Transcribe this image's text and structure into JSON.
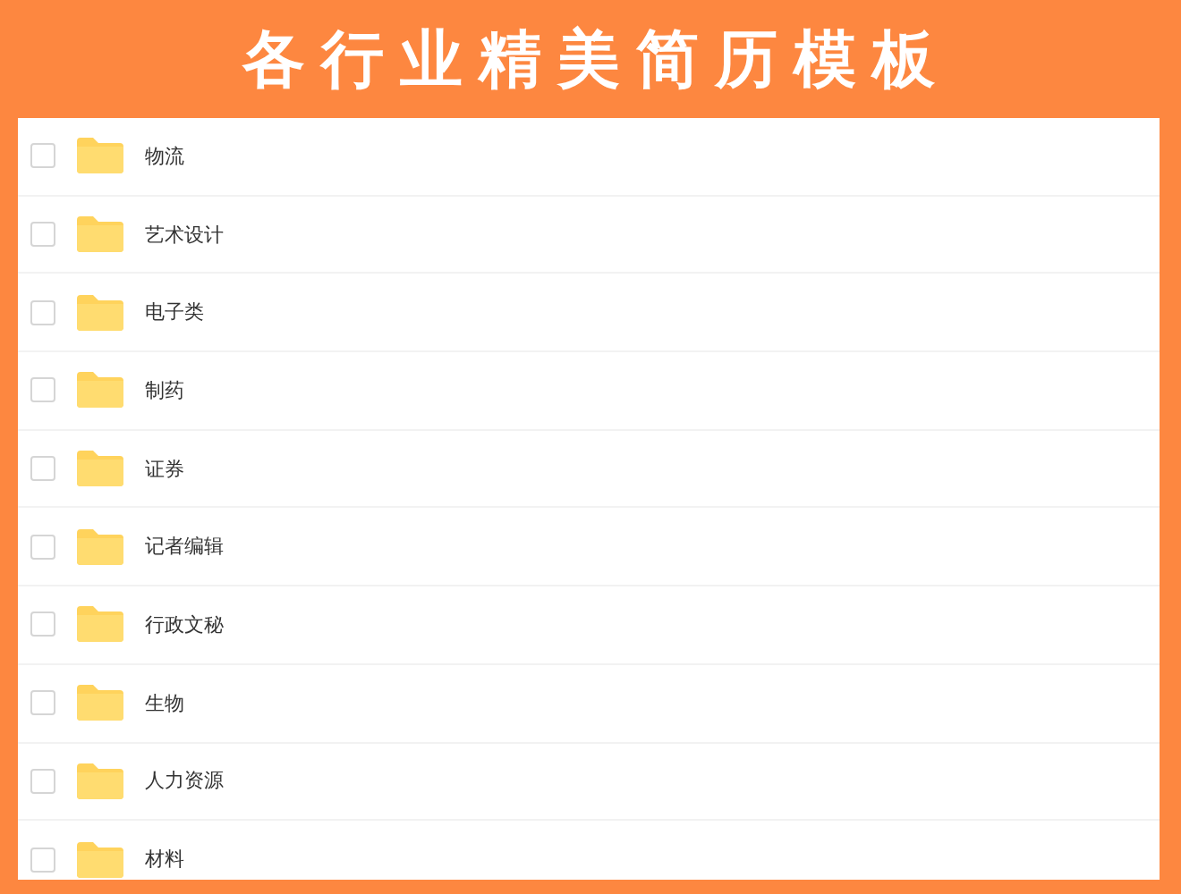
{
  "banner": {
    "title": "各行业精美简历模板"
  },
  "files": [
    {
      "name": "物流",
      "checked": false
    },
    {
      "name": "艺术设计",
      "checked": false
    },
    {
      "name": "电子类",
      "checked": false
    },
    {
      "name": "制药",
      "checked": false
    },
    {
      "name": "证券",
      "checked": false
    },
    {
      "name": "记者编辑",
      "checked": false
    },
    {
      "name": "行政文秘",
      "checked": false
    },
    {
      "name": "生物",
      "checked": false
    },
    {
      "name": "人力资源",
      "checked": false
    },
    {
      "name": "材料",
      "checked": false
    }
  ]
}
